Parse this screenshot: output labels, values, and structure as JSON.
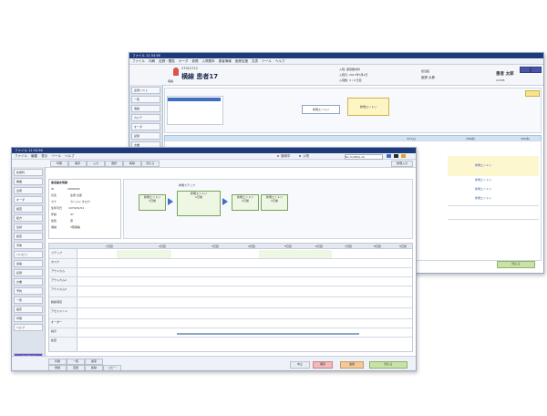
{
  "back_window": {
    "title": "ファイル 12.34.56 ",
    "menu": [
      "ファイル",
      "印刷",
      "記録・閲覧",
      "オーダ",
      "参照",
      "入院基本",
      "患者情報",
      "医療支援",
      "文書",
      "ツール",
      "ヘルプ"
    ],
    "patient": {
      "number": "27021712",
      "name": "横線 患者17",
      "gender_label": "男",
      "ward_label": "病棟"
    },
    "header_fields": {
      "admission_label": "入院: 循環器内科",
      "date_label": "入院日: 2017年3月4日",
      "days_label": "入院数: 3 / 9 日目",
      "doctor_label": "担当医",
      "doctor_value": "医師 太郎"
    },
    "right_header": {
      "name": "患者 太郎",
      "id": "12345"
    },
    "pathway_boxes": [
      "新規エントリ",
      "新規エントリ"
    ],
    "gantt_header_right": [
      "3/7(火)",
      "3/8(水)",
      "3/9(木)"
    ],
    "sidebar_items": [
      "患者リスト",
      "一覧",
      "病棟",
      "カルテ",
      "オーダ",
      "記録",
      "文書",
      "カレンダー"
    ],
    "table_rows": [
      "新規エントリ",
      "新規エントリ",
      "新規エントリ",
      "新規エントリ"
    ],
    "status_button": "閉じる"
  },
  "front_window": {
    "title": "ファイル 12.34.56",
    "menu": [
      "ファイル",
      "編集",
      "表示",
      "ツール",
      "ヘルプ"
    ],
    "toolbar": [
      "印刷",
      "保存",
      "入力",
      "選択",
      "削除",
      "閉じる",
      "新規入力"
    ],
    "legend_labels": [
      "適用中",
      "入院"
    ],
    "search_placeholder": "No.SurBAS-1A",
    "info_panel": {
      "title": "患者基本情報",
      "rows": [
        [
          "ID",
          "9999999"
        ],
        [
          "氏名",
          "患者 太郎"
        ],
        [
          "カナ",
          "カンジャ タロウ"
        ],
        [
          "生年月日",
          "1970/01/01"
        ],
        [
          "年齢",
          "47"
        ],
        [
          "性別",
          "男"
        ],
        [
          "病棟",
          "3階病棟"
        ]
      ]
    },
    "flow_boxes": [
      {
        "title": "新規エントリ",
        "sub": "1日後"
      },
      {
        "title": "新規エントリ",
        "sub": "1日後"
      },
      {
        "title": "新規エントリ",
        "sub": "1日後"
      },
      {
        "title": "新規エントリ",
        "sub": "1日後"
      }
    ],
    "flow_caption": "新規ステップ",
    "sidebar_items": [
      "診療科",
      "看護",
      "患者",
      "オーダ",
      "検査",
      "処方",
      "注射",
      "処置",
      "手術",
      "リハビリ",
      "栄養",
      "記録",
      "文書",
      "予約",
      "一覧",
      "設定",
      "印刷",
      "ヘルプ"
    ],
    "sidebar_bottom": "カルテを閉じる",
    "grid_cols": [
      "1日目",
      "2日目",
      "3日目",
      "4日目",
      "5日目",
      "6日目",
      "7日目",
      "8日目",
      "9日目"
    ],
    "grid_row_labels": [
      "ステップ",
      "タスク",
      "アウトカム",
      "アウトカム2",
      "アウトカム3",
      "観察項目",
      "アセスメント",
      "オーダー",
      "指示",
      "処置",
      "",
      ""
    ],
    "bottom_buttons": [
      "中止",
      "保存",
      "適用",
      "閉じる"
    ],
    "bottom_left_buttons": [
      "印刷",
      "一覧",
      "検索",
      "登録",
      "変更",
      "削除",
      "コピー"
    ]
  }
}
